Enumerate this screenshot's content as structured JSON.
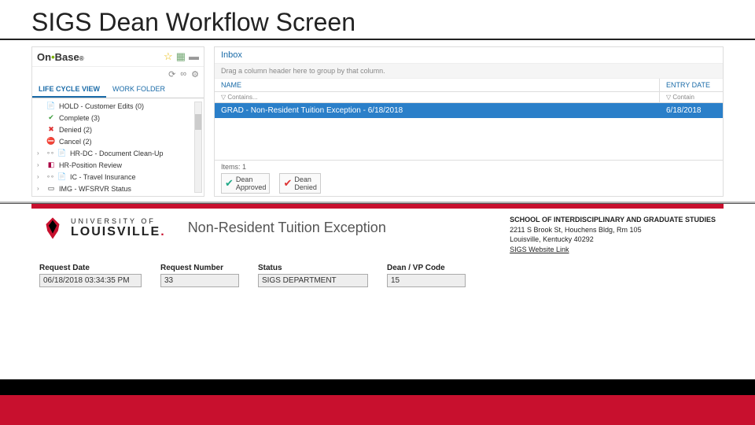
{
  "title": "SIGS Dean Workflow Screen",
  "logo": {
    "brand": "On",
    "brand2": "Base"
  },
  "leftPanel": {
    "tabs": [
      "LIFE CYCLE VIEW",
      "WORK FOLDER"
    ],
    "items": [
      {
        "indent": true,
        "icon": "doc",
        "label": "HOLD - Customer Edits (0)"
      },
      {
        "indent": true,
        "icon": "green",
        "label": "Complete (3)"
      },
      {
        "indent": true,
        "icon": "red",
        "label": "Denied (2)"
      },
      {
        "indent": true,
        "icon": "stop",
        "label": "Cancel (2)"
      },
      {
        "arrow": true,
        "icon": "dots",
        "label": "HR-DC - Document Clean-Up"
      },
      {
        "arrow": true,
        "icon": "purple",
        "label": "HR-Position Review"
      },
      {
        "arrow": true,
        "icon": "dots",
        "label": "IC - Travel Insurance"
      },
      {
        "arrow": true,
        "icon": "doc",
        "label": "IMG - WFSRVR Status"
      }
    ]
  },
  "rightPanel": {
    "tab": "Inbox",
    "hint": "Drag a column header here to group by that column.",
    "cols": {
      "name": "NAME",
      "date": "ENTRY DATE"
    },
    "filter": {
      "f1": "▽ Contains...",
      "f2": "▽ Contain"
    },
    "row": {
      "name": "GRAD - Non-Resident Tuition Exception - 6/18/2018",
      "date": "6/18/2018"
    },
    "itemsLabel": "Items: 1",
    "actions": [
      {
        "type": "check",
        "line1": "Dean",
        "line2": "Approved"
      },
      {
        "type": "cross",
        "line1": "Dean",
        "line2": "Denied"
      }
    ]
  },
  "form": {
    "univLine1": "UNIVERSITY OF",
    "univLine2": "LOUISVILLE",
    "heading": "Non-Resident Tuition Exception",
    "address": {
      "l1": "SCHOOL OF INTERDISCIPLINARY AND GRADUATE STUDIES",
      "l2": "2211 S Brook St, Houchens Bldg, Rm 105",
      "l3": "Louisville, Kentucky 40292",
      "l4": "SIGS Website Link"
    },
    "fields": {
      "requestDate": {
        "label": "Request Date",
        "value": "06/18/2018 03:34:35 PM"
      },
      "requestNumber": {
        "label": "Request Number",
        "value": "33"
      },
      "status": {
        "label": "Status",
        "value": "SIGS DEPARTMENT"
      },
      "deanCode": {
        "label": "Dean / VP Code",
        "value": "15"
      }
    }
  }
}
